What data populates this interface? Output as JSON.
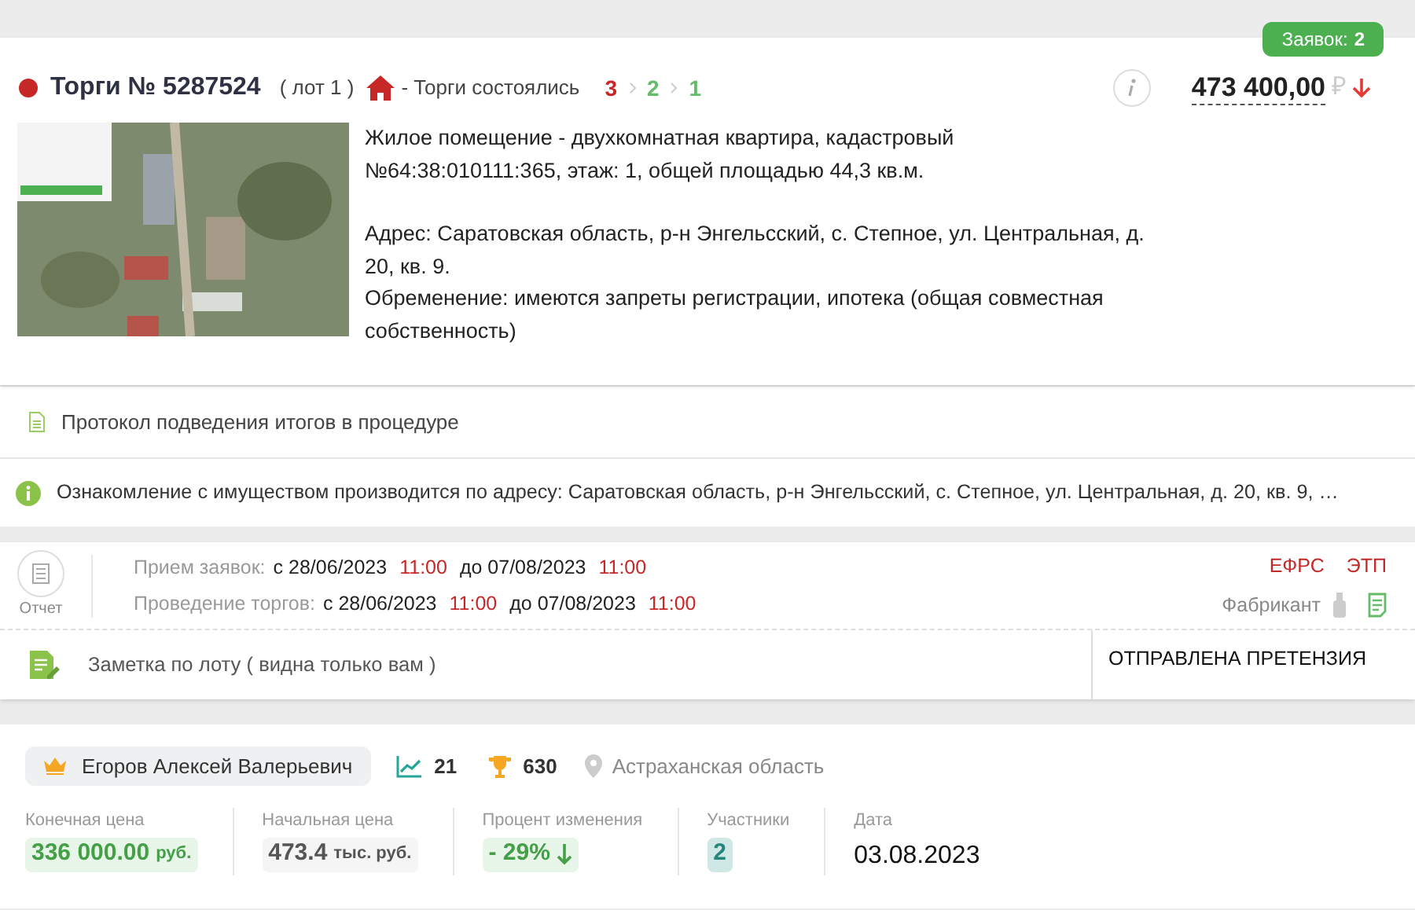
{
  "lot": {
    "title": "Торги № 5287524",
    "lot_label": "( лот 1 )",
    "status": "- Торги состоялись",
    "steps": [
      {
        "label": "3",
        "color": "#c62828"
      },
      {
        "label": "2",
        "color": "#66bb6a"
      },
      {
        "label": "1",
        "color": "#66bb6a"
      }
    ],
    "applications": {
      "label": "Заявок:",
      "count": "2"
    },
    "price": "473 400,00",
    "currency": "₽",
    "description": [
      "Жилое помещение - двухкомнатная квартира, кадастровый №64:38:010111:365, этаж: 1, общей площадью 44,3 кв.м.",
      "Адрес: Саратовская область, р-н Энгельсский, с. Степное, ул. Центральная, д. 20, кв. 9.",
      "Обременение: имеются запреты регистрации, ипотека (общая совместная собственность)"
    ]
  },
  "protocol_link": "Протокол подведения итогов в процедуре",
  "inspection_note": "Ознакомление с имуществом производится по адресу: Саратовская область, р-н Энгельсский, с. Степное, ул. Центральная, д. 20, кв. 9, …",
  "schedule": {
    "report_label": "Отчет",
    "rows": [
      {
        "label": "Прием заявок:",
        "from_prefix": "с",
        "from_date": "28/06/2023",
        "from_time": "11:00",
        "to_prefix": "до",
        "to_date": "07/08/2023",
        "to_time": "11:00"
      },
      {
        "label": "Проведение торгов:",
        "from_prefix": "с",
        "from_date": "28/06/2023",
        "from_time": "11:00",
        "to_prefix": "до",
        "to_date": "07/08/2023",
        "to_time": "11:00"
      }
    ],
    "sources": [
      "ЕФРС",
      "ЭТП"
    ],
    "platform": "Фабрикант",
    "note_placeholder": "Заметка по лоту ( видна только вам )",
    "claim_status": "ОТПРАВЛЕНА ПРЕТЕНЗИЯ"
  },
  "result": {
    "winner": "Егоров Алексей Валерьевич",
    "trend": "21",
    "trophies": "630",
    "region": "Астраханская область",
    "stats": [
      {
        "kind": "positive",
        "label": "Конечная цена",
        "value": "336 000.00",
        "unit": "руб."
      },
      {
        "kind": "neutral",
        "label": "Начальная цена",
        "value": "473.4",
        "unit": "тыс. руб."
      },
      {
        "kind": "change",
        "label": "Процент изменения",
        "value": "- 29%"
      },
      {
        "kind": "count",
        "label": "Участники",
        "value": "2"
      },
      {
        "kind": "plain",
        "label": "Дата",
        "value": "03.08.2023"
      }
    ]
  }
}
